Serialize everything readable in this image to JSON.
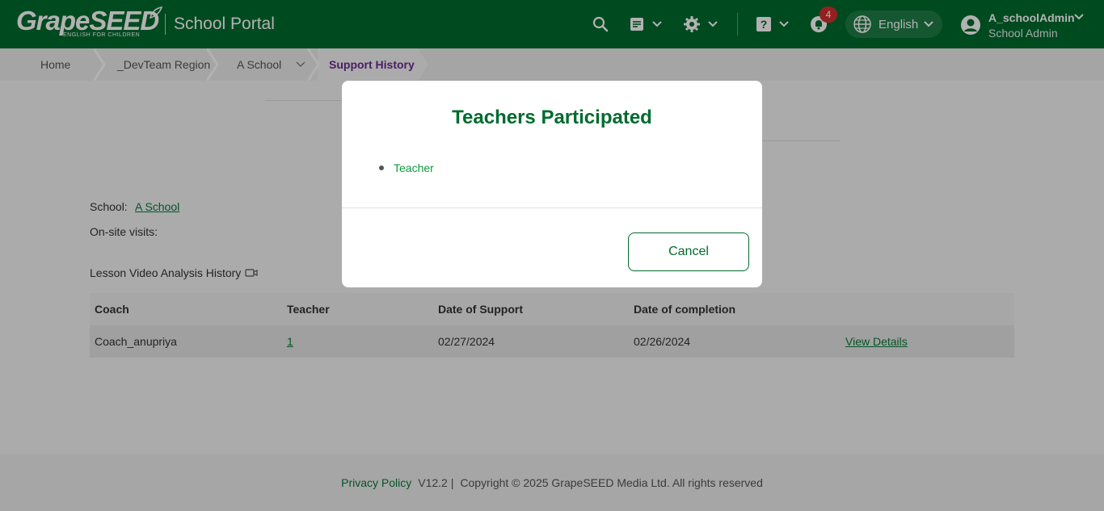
{
  "header": {
    "logo_text": "GrapeSEED",
    "logo_tagline": "ENGLISH FOR CHILDREN",
    "portal_title": "School Portal",
    "notifications_count": "4",
    "language": "English",
    "user_name": "A_schoolAdmin",
    "user_role": "School Admin"
  },
  "breadcrumb": {
    "home": "Home",
    "region": "_DevTeam Region",
    "school": "A School",
    "current": "Support History"
  },
  "page": {
    "school_label": "School:",
    "school_value": "A School",
    "onsite_label": "On-site visits:",
    "section_title": "Lesson Video Analysis History"
  },
  "table": {
    "headers": [
      "Coach",
      "Teacher",
      "Date of Support",
      "Date of completion"
    ],
    "rows": [
      {
        "coach": "Coach_anupriya",
        "teacher": "1",
        "date_support": "02/27/2024",
        "date_completion": "02/26/2024",
        "action": "View Details"
      }
    ]
  },
  "footer": {
    "privacy": "Privacy Policy",
    "version": "V12.2 |",
    "copyright": "Copyright © 2025 GrapeSEED Media Ltd. All rights reserved"
  },
  "modal": {
    "title": "Teachers Participated",
    "items": [
      "Teacher"
    ],
    "cancel_label": "Cancel"
  },
  "colors": {
    "brand_green": "#006b2e",
    "link_green": "#0a7a3a",
    "breadcrumb_active": "#6a2c91",
    "badge_red": "#d32f2f"
  }
}
